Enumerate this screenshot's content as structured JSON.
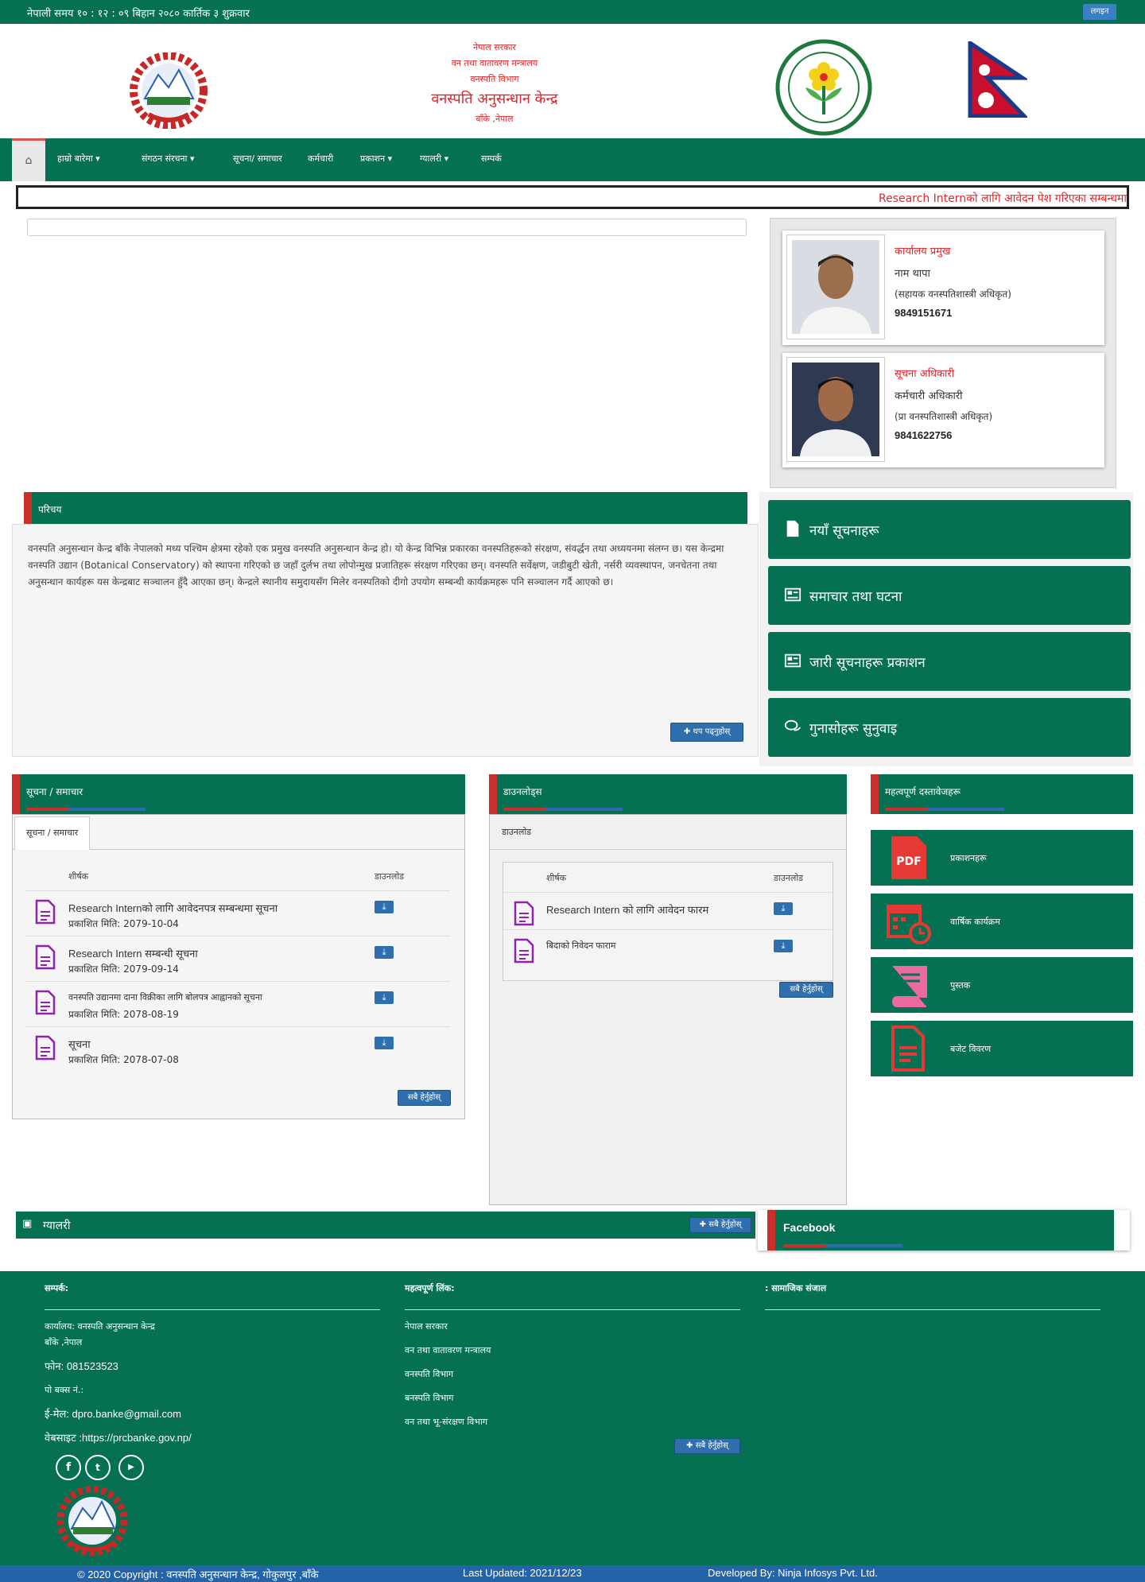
{
  "topbar": {
    "time": "नेपाली समय १० : १२ : ०९ बिहान   २०८० कार्तिक ३ शुक्रवार",
    "button": "लगइन"
  },
  "header": {
    "line1": "नेपाल सरकार",
    "line2": "वन तथा वातावरण मन्त्रालय",
    "line3": "वनस्पति विभाग",
    "title": "वनस्पति अनुसन्धान केन्द्र",
    "location": "बाँके ,नेपाल"
  },
  "nav": {
    "items": [
      "हाम्रो बारेमा",
      "संगठन संरचना",
      "सूचना/ समाचार",
      "कर्मचारी",
      "प्रकाशन",
      "ग्यालरी",
      "सम्पर्क"
    ]
  },
  "marquee": "Research Internको लागि आवेदन पेश गरिएका सम्बन्धमा",
  "officials": [
    {
      "role": "कार्यालय प्रमुख",
      "name": "नाम थापा",
      "post": "(सहायक वनस्पतिशास्त्री अधिकृत)",
      "phone": "9849151671"
    },
    {
      "role": "सूचना अधिकारी",
      "name": "कर्मचारी अधिकारी",
      "post": "(प्रा वनस्पतिशास्त्री अधिकृत)",
      "phone": "9841622756"
    }
  ],
  "about": {
    "heading": "परिचय",
    "body": "वनस्पति अनुसन्धान केन्द्र बाँके नेपालको मध्य पश्चिम क्षेत्रमा रहेको एक प्रमुख वनस्पति अनुसन्धान केन्द्र हो। यो केन्द्र विभिन्न प्रकारका वनस्पतिहरूको संरक्षण, संवर्द्धन तथा अध्ययनमा संलग्न छ। यस केन्द्रमा वनस्पति उद्यान (Botanical Conservatory) को स्थापना गरिएको छ जहाँ दुर्लभ तथा लोपोन्मुख प्रजातिहरू संरक्षण गरिएका छन्। वनस्पति सर्वेक्षण, जडीबुटी खेती, नर्सरी व्यवस्थापन, जनचेतना तथा अनुसन्धान कार्यहरू यस केन्द्रबाट सञ्चालन हुँदै आएका छन्। केन्द्रले स्थानीय समुदायसँग मिलेर वनस्पतिको दीगो उपयोग सम्बन्धी कार्यक्रमहरू पनि सञ्चालन गर्दै आएको छ।",
    "more": "थप पढ्नुहोस्"
  },
  "quick_links": [
    "नयाँ सूचनाहरू",
    "समाचार तथा घटना",
    "जारी सूचनाहरू प्रकाशन",
    "गुनासोहरू सुनुवाइ"
  ],
  "notices": {
    "heading": "सूचना / समाचार",
    "tab": "सूचना / समाचार",
    "col_title": "शीर्षक",
    "col_download": "डाउनलोड",
    "rows": [
      {
        "title": "Research Internको लागि आवेदनपत्र सम्बन्धमा सूचना",
        "date": "प्रकाशित मिति: 2079-10-04"
      },
      {
        "title": "Research Intern सम्बन्धी सूचना",
        "date": "प्रकाशित मिति: 2079-09-14"
      },
      {
        "title": "वनस्पति उद्यानमा दाना विक्रीका लागि बोलपत्र आह्वानको सूचना",
        "date": "प्रकाशित मिति: 2078-08-19"
      },
      {
        "title": "सूचना",
        "date": "प्रकाशित मिति: 2078-07-08"
      }
    ],
    "all_button": "सबै हेर्नुहोस्"
  },
  "news": {
    "heading": "डाउनलोड्स",
    "tab": "डाउनलोड",
    "col_title": "शीर्षक",
    "col_download": "डाउनलोड",
    "rows": [
      {
        "title": "Research Intern को लागि आवेदन फारम"
      },
      {
        "title": "बिदाको निवेदन फाराम"
      }
    ],
    "all_button": "सबै हेर्नुहोस्"
  },
  "resources": {
    "heading": "महत्वपूर्ण दस्तावेजहरू",
    "items": [
      {
        "label": "प्रकाशनहरू",
        "icon": "pdf-icon"
      },
      {
        "label": "वार्षिक कार्यक्रम",
        "icon": "calendar-icon"
      },
      {
        "label": "पुस्तक",
        "icon": "book-icon"
      },
      {
        "label": "बजेट विवरण",
        "icon": "document-icon"
      }
    ]
  },
  "gallery": {
    "heading": "ग्यालरी",
    "button": "सबै हेर्नुहोस्"
  },
  "facebook": {
    "heading": "Facebook"
  },
  "footer": {
    "contact_title": "सम्पर्क:",
    "office": "कार्यालय: वनस्पति अनुसन्धान केन्द्र",
    "office_loc": "बाँके ,नेपाल",
    "phone": "फोन: 081523523",
    "pobox": "पो बक्स नं.:",
    "email": "ई-मेल: dpro.banke@gmail.com",
    "website": "वेबसाइट :https://prcbanke.gov.np/",
    "links_title": "महत्वपूर्ण लिंक:",
    "links": [
      "नेपाल सरकार",
      "वन तथा वातावरण मन्त्रालय",
      "वनस्पति विभाग",
      "बनस्पति विभाग",
      "वन तथा भू-संरक्षण विभाग"
    ],
    "links_button": "सबै हेर्नुहोस्",
    "third_title": ": सामाजिक संजाल",
    "copyright": "© 2020 Copyright : वनस्पति अनुसन्धान केन्द्र, गोकुलपुर ,बाँके",
    "updated": "Last Updated: 2021/12/23",
    "developer": "Developed By: Ninja Infosys Pvt. Ltd."
  }
}
